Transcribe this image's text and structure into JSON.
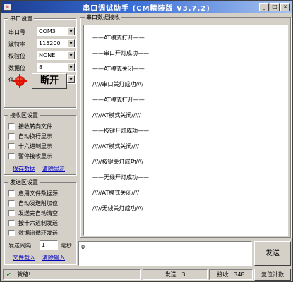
{
  "window": {
    "title": "串口调试助手 (CM精装版 V3.7.2)",
    "app_icon_glyph": "≡",
    "minimize_glyph": "_",
    "maximize_glyph": "□",
    "close_glyph": "×"
  },
  "serial_settings": {
    "title": "串口设置",
    "fields": [
      {
        "label": "串口号",
        "value": "COM3"
      },
      {
        "label": "波特率",
        "value": "115200"
      },
      {
        "label": "校验位",
        "value": "NONE"
      },
      {
        "label": "数据位",
        "value": "8"
      },
      {
        "label": "停止位",
        "value": "1"
      }
    ],
    "dropdown_glyph": "▼",
    "toggle_label": "断开",
    "lamp_color": "#e01000"
  },
  "receive_settings": {
    "title": "接收区设置",
    "options": [
      "接收转向文件...",
      "自动换行显示",
      "十六进制显示",
      "暂停接收显示"
    ],
    "save_link": "保存数据",
    "clear_link": "清除显示"
  },
  "send_settings": {
    "title": "发送区设置",
    "options": [
      "启用文件数据源...",
      "自动发送附加位",
      "发送完自动清空",
      "按十六进制发送",
      "数据流循环发送"
    ],
    "interval_label": "发送间隔",
    "interval_value": "1",
    "interval_unit": "毫秒",
    "file_load_link": "文件载入",
    "clear_input_link": "清除输入"
  },
  "receive_area": {
    "title": "串口数据接收",
    "lines": [
      "——AT模式打开——",
      "——串口开灯成功——",
      "——AT模式关闭——",
      "/////串口关灯成功////",
      "——AT模式打开——",
      "/////AT模式关闭/////",
      "——按键开灯成功——",
      "/////AT模式关闭////",
      "/////按键关灯成功////",
      "——无线开灯成功——",
      "/////AT模式关闭////",
      "/////无线关灯成功////"
    ]
  },
  "send_area": {
    "input_value": "0",
    "send_button": "发送"
  },
  "status_bar": {
    "icon": "✔",
    "status_text": "就绪!",
    "sent_label": "发送 : 3",
    "received_label": "接收 : 348",
    "reset_button": "复位计数"
  }
}
